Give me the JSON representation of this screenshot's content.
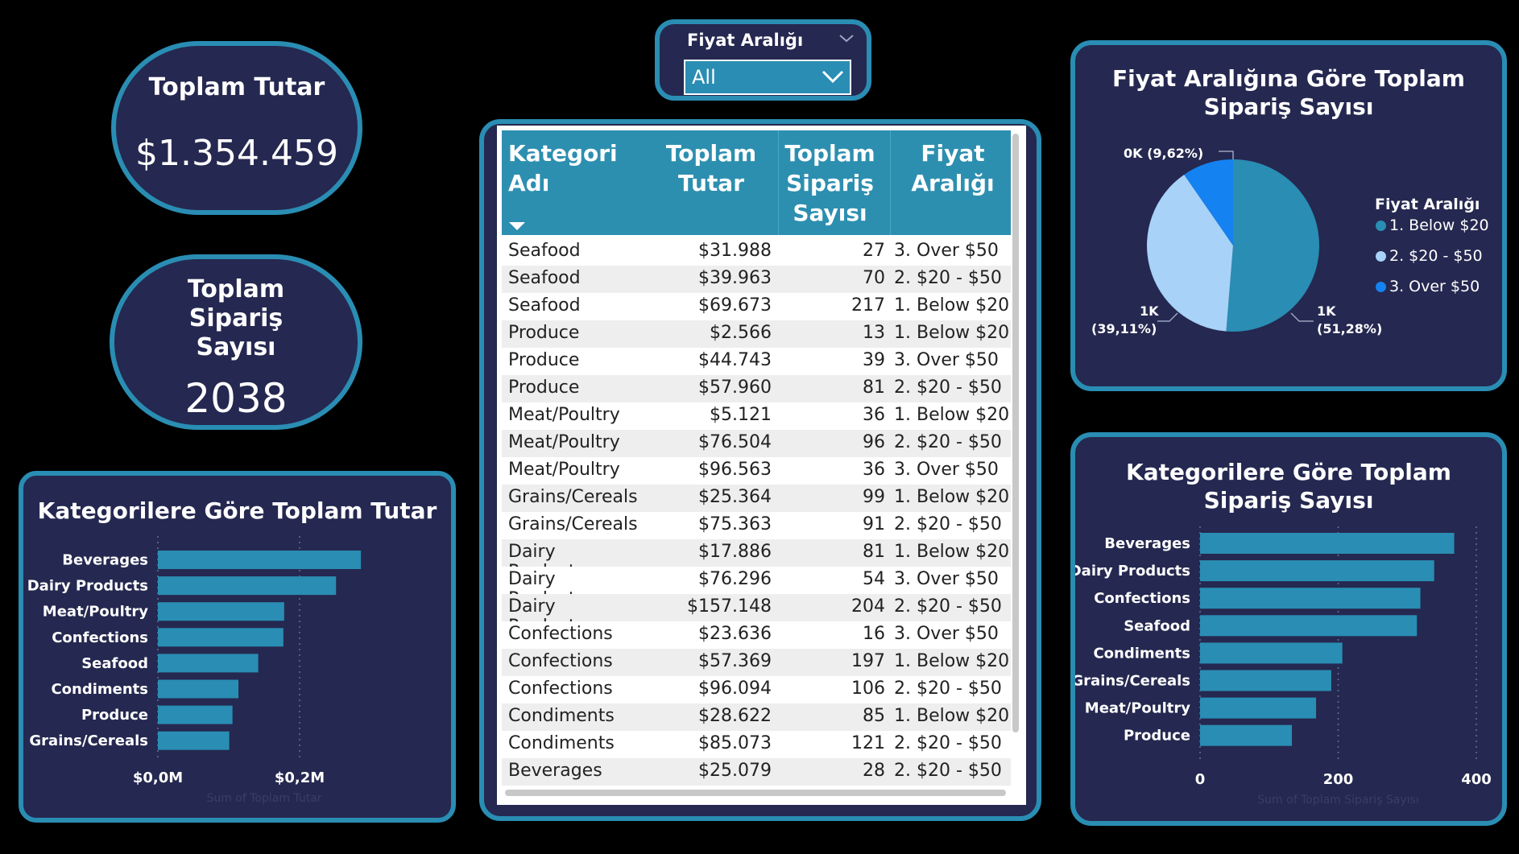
{
  "kpi_total": {
    "title": "Toplam Tutar",
    "value": "$1.354.459"
  },
  "kpi_orders": {
    "title": "Toplam Sipariş Sayısı",
    "value": "2038"
  },
  "slicer": {
    "title": "Fiyat Aralığı",
    "value": "All"
  },
  "table": {
    "headers": [
      "Kategori Adı",
      "Toplam Tutar",
      "Toplam Sipariş Sayısı",
      "Fiyat Aralığı"
    ],
    "rows": [
      [
        "Seafood",
        "$31.988",
        "27",
        "3. Over $50"
      ],
      [
        "Seafood",
        "$39.963",
        "70",
        "2. $20 - $50"
      ],
      [
        "Seafood",
        "$69.673",
        "217",
        "1. Below $20"
      ],
      [
        "Produce",
        "$2.566",
        "13",
        "1. Below $20"
      ],
      [
        "Produce",
        "$44.743",
        "39",
        "3. Over $50"
      ],
      [
        "Produce",
        "$57.960",
        "81",
        "2. $20 - $50"
      ],
      [
        "Meat/Poultry",
        "$5.121",
        "36",
        "1. Below $20"
      ],
      [
        "Meat/Poultry",
        "$76.504",
        "96",
        "2. $20 - $50"
      ],
      [
        "Meat/Poultry",
        "$96.563",
        "36",
        "3. Over $50"
      ],
      [
        "Grains/Cereals",
        "$25.364",
        "99",
        "1. Below $20"
      ],
      [
        "Grains/Cereals",
        "$75.363",
        "91",
        "2. $20 - $50"
      ],
      [
        "Dairy Products",
        "$17.886",
        "81",
        "1. Below $20"
      ],
      [
        "Dairy Products",
        "$76.296",
        "54",
        "3. Over $50"
      ],
      [
        "Dairy Products",
        "$157.148",
        "204",
        "2. $20 - $50"
      ],
      [
        "Confections",
        "$23.636",
        "16",
        "3. Over $50"
      ],
      [
        "Confections",
        "$57.369",
        "197",
        "1. Below $20"
      ],
      [
        "Confections",
        "$96.094",
        "106",
        "2. $20 - $50"
      ],
      [
        "Condiments",
        "$28.622",
        "85",
        "1. Below $20"
      ],
      [
        "Condiments",
        "$85.073",
        "121",
        "2. $20 - $50"
      ],
      [
        "Beverages",
        "$25.079",
        "28",
        "2. $20 - $50"
      ]
    ]
  },
  "colors": {
    "bar": "#2a8db3",
    "panel": "#252850",
    "border": "#2a8db3",
    "pie": [
      "#2a8db3",
      "#a8d2f8",
      "#1482f0"
    ]
  },
  "chart_data": [
    {
      "type": "pie",
      "title": "Fiyat Aralığına Göre Toplam Sipariş Sayısı",
      "legend_title": "Fiyat Aralığı",
      "categories": [
        "1. Below $20",
        "2. $20 - $50",
        "3. Over $50"
      ],
      "values": [
        1045,
        797,
        196
      ],
      "data_labels": [
        [
          "1K",
          "(51,28%)"
        ],
        [
          "1K",
          "(39,11%)"
        ],
        [
          "0K (9,62%)"
        ]
      ],
      "legend": "right"
    },
    {
      "type": "bar",
      "title": "Kategorilere Göre Toplam Tutar",
      "categories": [
        "Beverages",
        "Dairy Products",
        "Meat/Poultry",
        "Confections",
        "Seafood",
        "Condiments",
        "Produce",
        "Grains/Cereals"
      ],
      "values": [
        286500,
        251400,
        178200,
        177100,
        141600,
        113700,
        105300,
        100700
      ],
      "xticks": [
        0,
        200000
      ],
      "xtick_labels": [
        "$0,0M",
        "$0,2M"
      ],
      "xlim": [
        0,
        300000
      ],
      "xlabel": "Sum of Toplam Tutar"
    },
    {
      "type": "bar",
      "title": "Kategorilere Göre Toplam Sipariş Sayısı",
      "categories": [
        "Beverages",
        "Dairy Products",
        "Confections",
        "Seafood",
        "Condiments",
        "Grains/Cereals",
        "Meat/Poultry",
        "Produce"
      ],
      "values": [
        368,
        339,
        319,
        314,
        206,
        190,
        168,
        133
      ],
      "xticks": [
        0,
        200,
        400
      ],
      "xtick_labels": [
        "0",
        "200",
        "400"
      ],
      "xlim": [
        0,
        400
      ],
      "xlabel": "Sum of Toplam Sipariş Sayısı"
    }
  ]
}
